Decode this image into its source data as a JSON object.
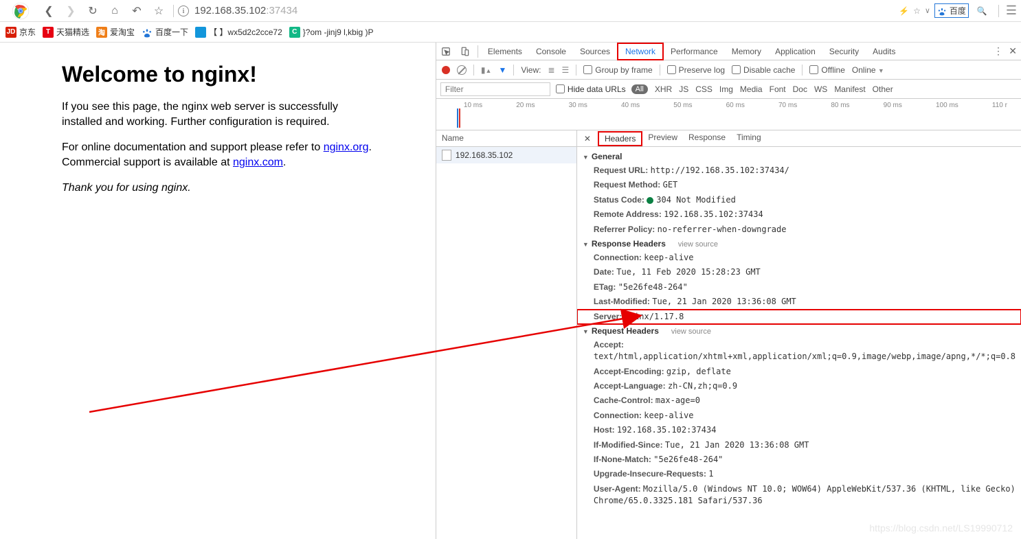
{
  "browser": {
    "url_host": "192.168.35.102",
    "url_port": ":37434",
    "search_engine": "百度"
  },
  "bookmarks": [
    {
      "icon_bg": "#d81e06",
      "icon_txt": "JD",
      "label": "京东"
    },
    {
      "icon_bg": "#e60012",
      "icon_txt": "T",
      "label": "天猫精选"
    },
    {
      "icon_bg": "#ef7e18",
      "icon_txt": "淘",
      "label": "爱淘宝"
    },
    {
      "icon_bg": "#2376d7",
      "icon_txt": "",
      "label": "百度一下",
      "is_paw": true
    },
    {
      "icon_bg": "#1296db",
      "icon_txt": "",
      "label": "【 】wx5d2c2cce72"
    },
    {
      "icon_bg": "#12b886",
      "icon_txt": "C",
      "label": "}?om -jinj9 l,kbig )P"
    }
  ],
  "page": {
    "h1": "Welcome to nginx!",
    "p1": "If you see this page, the nginx web server is successfully installed and working. Further configuration is required.",
    "p2a": "For online documentation and support please refer to ",
    "link1": "nginx.org",
    "p2b": ".",
    "p3a": "Commercial support is available at ",
    "link2": "nginx.com",
    "p3b": ".",
    "thank": "Thank you for using nginx."
  },
  "devtools": {
    "tabs": [
      "Elements",
      "Console",
      "Sources",
      "Network",
      "Performance",
      "Memory",
      "Application",
      "Security",
      "Audits"
    ],
    "toolbar": {
      "view": "View:",
      "group": "Group by frame",
      "preserve": "Preserve log",
      "disable": "Disable cache",
      "offline": "Offline",
      "online": "Online"
    },
    "filter": {
      "placeholder": "Filter",
      "hide": "Hide data URLs",
      "types": [
        "All",
        "XHR",
        "JS",
        "CSS",
        "Img",
        "Media",
        "Font",
        "Doc",
        "WS",
        "Manifest",
        "Other"
      ]
    },
    "timeline": [
      "10 ms",
      "20 ms",
      "30 ms",
      "40 ms",
      "50 ms",
      "60 ms",
      "70 ms",
      "80 ms",
      "90 ms",
      "100 ms",
      "110 r"
    ],
    "name_header": "Name",
    "request_name": "192.168.35.102",
    "detail_tabs": [
      "Headers",
      "Preview",
      "Response",
      "Timing"
    ],
    "general": {
      "title": "General",
      "items": [
        {
          "k": "Request URL:",
          "v": "http://192.168.35.102:37434/"
        },
        {
          "k": "Request Method:",
          "v": "GET"
        },
        {
          "k": "Status Code:",
          "v": "304 Not Modified",
          "status": true
        },
        {
          "k": "Remote Address:",
          "v": "192.168.35.102:37434"
        },
        {
          "k": "Referrer Policy:",
          "v": "no-referrer-when-downgrade"
        }
      ]
    },
    "response_headers": {
      "title": "Response Headers",
      "vs": "view source",
      "items": [
        {
          "k": "Connection:",
          "v": "keep-alive"
        },
        {
          "k": "Date:",
          "v": "Tue, 11 Feb 2020 15:28:23 GMT"
        },
        {
          "k": "ETag:",
          "v": "\"5e26fe48-264\""
        },
        {
          "k": "Last-Modified:",
          "v": "Tue, 21 Jan 2020 13:36:08 GMT"
        },
        {
          "k": "Server:",
          "v": "nginx/1.17.8",
          "highlight": true
        }
      ]
    },
    "request_headers": {
      "title": "Request Headers",
      "vs": "view source",
      "items": [
        {
          "k": "Accept:",
          "v": "text/html,application/xhtml+xml,application/xml;q=0.9,image/webp,image/apng,*/*;q=0.8"
        },
        {
          "k": "Accept-Encoding:",
          "v": "gzip, deflate"
        },
        {
          "k": "Accept-Language:",
          "v": "zh-CN,zh;q=0.9"
        },
        {
          "k": "Cache-Control:",
          "v": "max-age=0"
        },
        {
          "k": "Connection:",
          "v": "keep-alive"
        },
        {
          "k": "Host:",
          "v": "192.168.35.102:37434"
        },
        {
          "k": "If-Modified-Since:",
          "v": "Tue, 21 Jan 2020 13:36:08 GMT"
        },
        {
          "k": "If-None-Match:",
          "v": "\"5e26fe48-264\""
        },
        {
          "k": "Upgrade-Insecure-Requests:",
          "v": "1"
        },
        {
          "k": "User-Agent:",
          "v": "Mozilla/5.0 (Windows NT 10.0; WOW64) AppleWebKit/537.36 (KHTML, like Gecko) Chrome/65.0.3325.181 Safari/537.36"
        }
      ]
    }
  },
  "watermark": "https://blog.csdn.net/LS19990712"
}
